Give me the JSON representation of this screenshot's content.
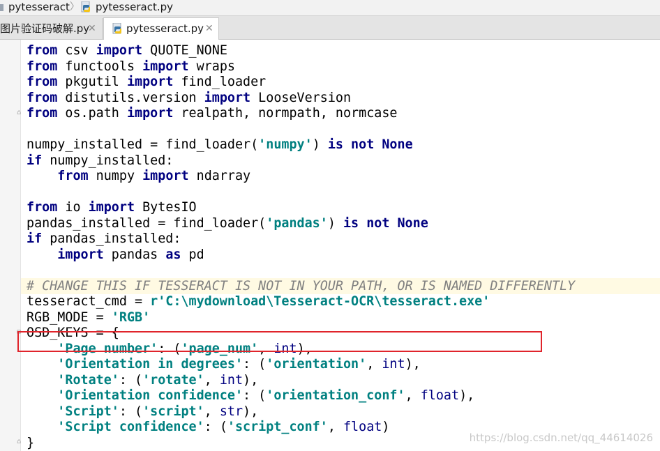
{
  "breadcrumb": {
    "folder": "pytesseract",
    "file": "pytesseract.py"
  },
  "tabs": [
    {
      "label": "图片验证码破解.py",
      "active": false
    },
    {
      "label": "pytesseract.py",
      "active": true
    }
  ],
  "editor": {
    "lines": [
      [
        [
          "kw",
          "from"
        ],
        [
          "t",
          " csv "
        ],
        [
          "kw",
          "import"
        ],
        [
          "t",
          " QUOTE_NONE"
        ]
      ],
      [
        [
          "kw",
          "from"
        ],
        [
          "t",
          " functools "
        ],
        [
          "kw",
          "import"
        ],
        [
          "t",
          " wraps"
        ]
      ],
      [
        [
          "kw",
          "from"
        ],
        [
          "t",
          " pkgutil "
        ],
        [
          "kw",
          "import"
        ],
        [
          "t",
          " find_loader"
        ]
      ],
      [
        [
          "kw",
          "from"
        ],
        [
          "t",
          " distutils.version "
        ],
        [
          "kw",
          "import"
        ],
        [
          "t",
          " LooseVersion"
        ]
      ],
      [
        [
          "kw",
          "from"
        ],
        [
          "t",
          " os.path "
        ],
        [
          "kw",
          "import"
        ],
        [
          "t",
          " realpath, normpath, normcase"
        ]
      ],
      [],
      [
        [
          "t",
          "numpy_installed = find_loader("
        ],
        [
          "str",
          "'numpy'"
        ],
        [
          "t",
          ") "
        ],
        [
          "kw",
          "is not None"
        ]
      ],
      [
        [
          "kw",
          "if"
        ],
        [
          "t",
          " numpy_installed:"
        ]
      ],
      [
        [
          "t",
          "    "
        ],
        [
          "kw",
          "from"
        ],
        [
          "t",
          " numpy "
        ],
        [
          "kw",
          "import"
        ],
        [
          "t",
          " ndarray"
        ]
      ],
      [],
      [
        [
          "kw",
          "from"
        ],
        [
          "t",
          " io "
        ],
        [
          "kw",
          "import"
        ],
        [
          "t",
          " BytesIO"
        ]
      ],
      [
        [
          "t",
          "pandas_installed = find_loader("
        ],
        [
          "str",
          "'pandas'"
        ],
        [
          "t",
          ") "
        ],
        [
          "kw",
          "is not None"
        ]
      ],
      [
        [
          "kw",
          "if"
        ],
        [
          "t",
          " pandas_installed:"
        ]
      ],
      [
        [
          "t",
          "    "
        ],
        [
          "kw",
          "import"
        ],
        [
          "t",
          " pandas "
        ],
        [
          "kw",
          "as"
        ],
        [
          "t",
          " pd"
        ]
      ],
      [],
      [
        [
          "cm",
          "# CHANGE THIS IF TESSERACT IS NOT IN YOUR PATH, OR IS NAMED DIFFERENTLY"
        ]
      ],
      [
        [
          "t",
          "tesseract_cmd = "
        ],
        [
          "str",
          "r'C:\\mydownload\\Tesseract-OCR\\tesseract.exe'"
        ]
      ],
      [
        [
          "t",
          "RGB_MODE = "
        ],
        [
          "str",
          "'RGB'"
        ]
      ],
      [
        [
          "t",
          "OSD_KEYS = {"
        ]
      ],
      [
        [
          "t",
          "    "
        ],
        [
          "str",
          "'Page number'"
        ],
        [
          "t",
          ": ("
        ],
        [
          "str",
          "'page_num'"
        ],
        [
          "t",
          ", "
        ],
        [
          "bi",
          "int"
        ],
        [
          "t",
          "),"
        ]
      ],
      [
        [
          "t",
          "    "
        ],
        [
          "str",
          "'Orientation in degrees'"
        ],
        [
          "t",
          ": ("
        ],
        [
          "str",
          "'orientation'"
        ],
        [
          "t",
          ", "
        ],
        [
          "bi",
          "int"
        ],
        [
          "t",
          "),"
        ]
      ],
      [
        [
          "t",
          "    "
        ],
        [
          "str",
          "'Rotate'"
        ],
        [
          "t",
          ": ("
        ],
        [
          "str",
          "'rotate'"
        ],
        [
          "t",
          ", "
        ],
        [
          "bi",
          "int"
        ],
        [
          "t",
          "),"
        ]
      ],
      [
        [
          "t",
          "    "
        ],
        [
          "str",
          "'Orientation confidence'"
        ],
        [
          "t",
          ": ("
        ],
        [
          "str",
          "'orientation_conf'"
        ],
        [
          "t",
          ", "
        ],
        [
          "bi",
          "float"
        ],
        [
          "t",
          "),"
        ]
      ],
      [
        [
          "t",
          "    "
        ],
        [
          "str",
          "'Script'"
        ],
        [
          "t",
          ": ("
        ],
        [
          "str",
          "'script'"
        ],
        [
          "t",
          ", "
        ],
        [
          "bi",
          "str"
        ],
        [
          "t",
          "),"
        ]
      ],
      [
        [
          "t",
          "    "
        ],
        [
          "str",
          "'Script confidence'"
        ],
        [
          "t",
          ": ("
        ],
        [
          "str",
          "'script_conf'"
        ],
        [
          "t",
          ", "
        ],
        [
          "bi",
          "float"
        ],
        [
          "t",
          ")"
        ]
      ],
      [
        [
          "t",
          "}"
        ]
      ]
    ]
  },
  "watermark": "https://blog.csdn.net/qq_44614026",
  "colors": {
    "keyword": "#000080",
    "string": "#008080",
    "comment": "#808080",
    "highlight_box": "#e0242b",
    "current_line": "#fffae3"
  },
  "icons": {
    "folder": "folder-icon",
    "python_file": "python-file-icon",
    "close": "close-icon",
    "fold": "fold-marker-icon"
  }
}
